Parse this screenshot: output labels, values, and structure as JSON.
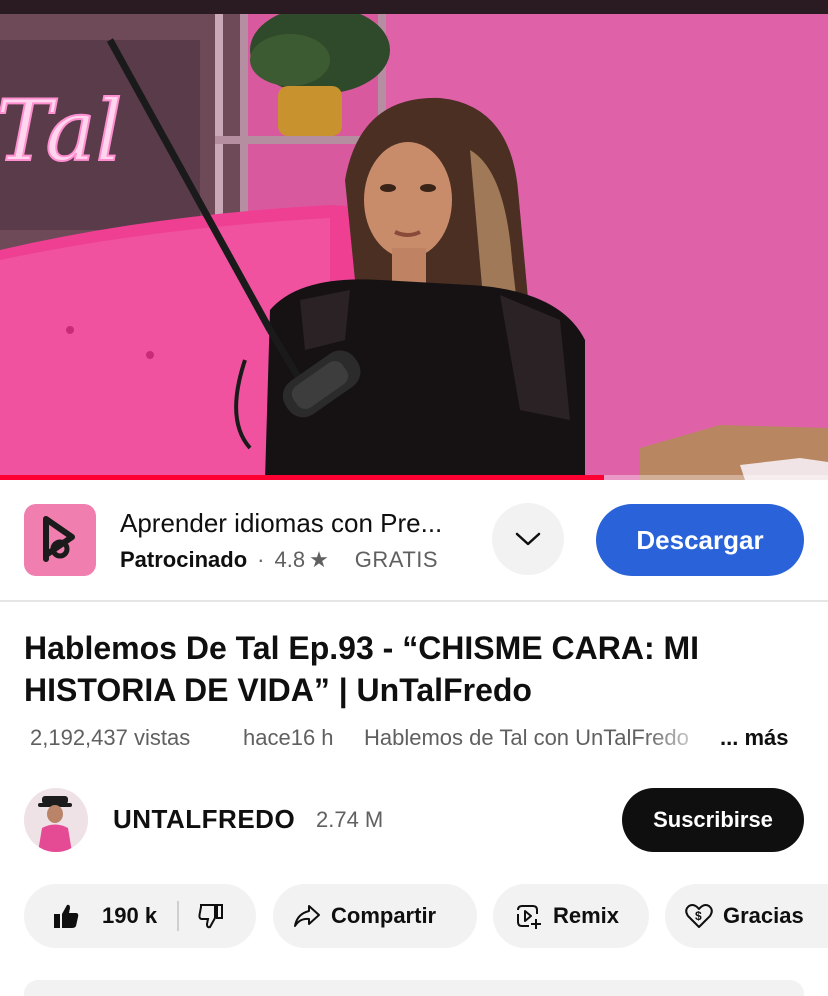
{
  "player": {
    "neon_sign": "Tal",
    "progress_fraction": 0.73,
    "accent_color": "#ff0033"
  },
  "ad": {
    "icon": "app-logo-icon",
    "title": "Aprender idiomas con Pre...",
    "sponsored_label": "Patrocinado",
    "separator": "·",
    "rating": "4.8",
    "rating_icon": "star-icon",
    "price": "GRATIS",
    "expand_icon": "chevron-down-icon",
    "cta_label": "Descargar",
    "cta_color": "#2962d9"
  },
  "video": {
    "title": "Hablemos De Tal Ep.93 - “CHISME CARA: MI HISTORIA DE VIDA” | UnTalFredo",
    "views": "2,192,437 vistas",
    "age": "hace16 h",
    "playlist": "Hablemos de Tal con UnTalFredo",
    "more_label": "... más"
  },
  "channel": {
    "name": "UNTALFREDO",
    "subscribers": "2.74 M",
    "subscribe_label": "Suscribirse"
  },
  "actions": {
    "likes": "190 k",
    "like_icon": "thumbs-up-icon",
    "dislike_icon": "thumbs-down-icon",
    "share_label": "Compartir",
    "share_icon": "share-arrow-icon",
    "remix_label": "Remix",
    "remix_icon": "remix-icon",
    "thanks_label": "Gracias",
    "thanks_icon": "heart-dollar-icon"
  }
}
